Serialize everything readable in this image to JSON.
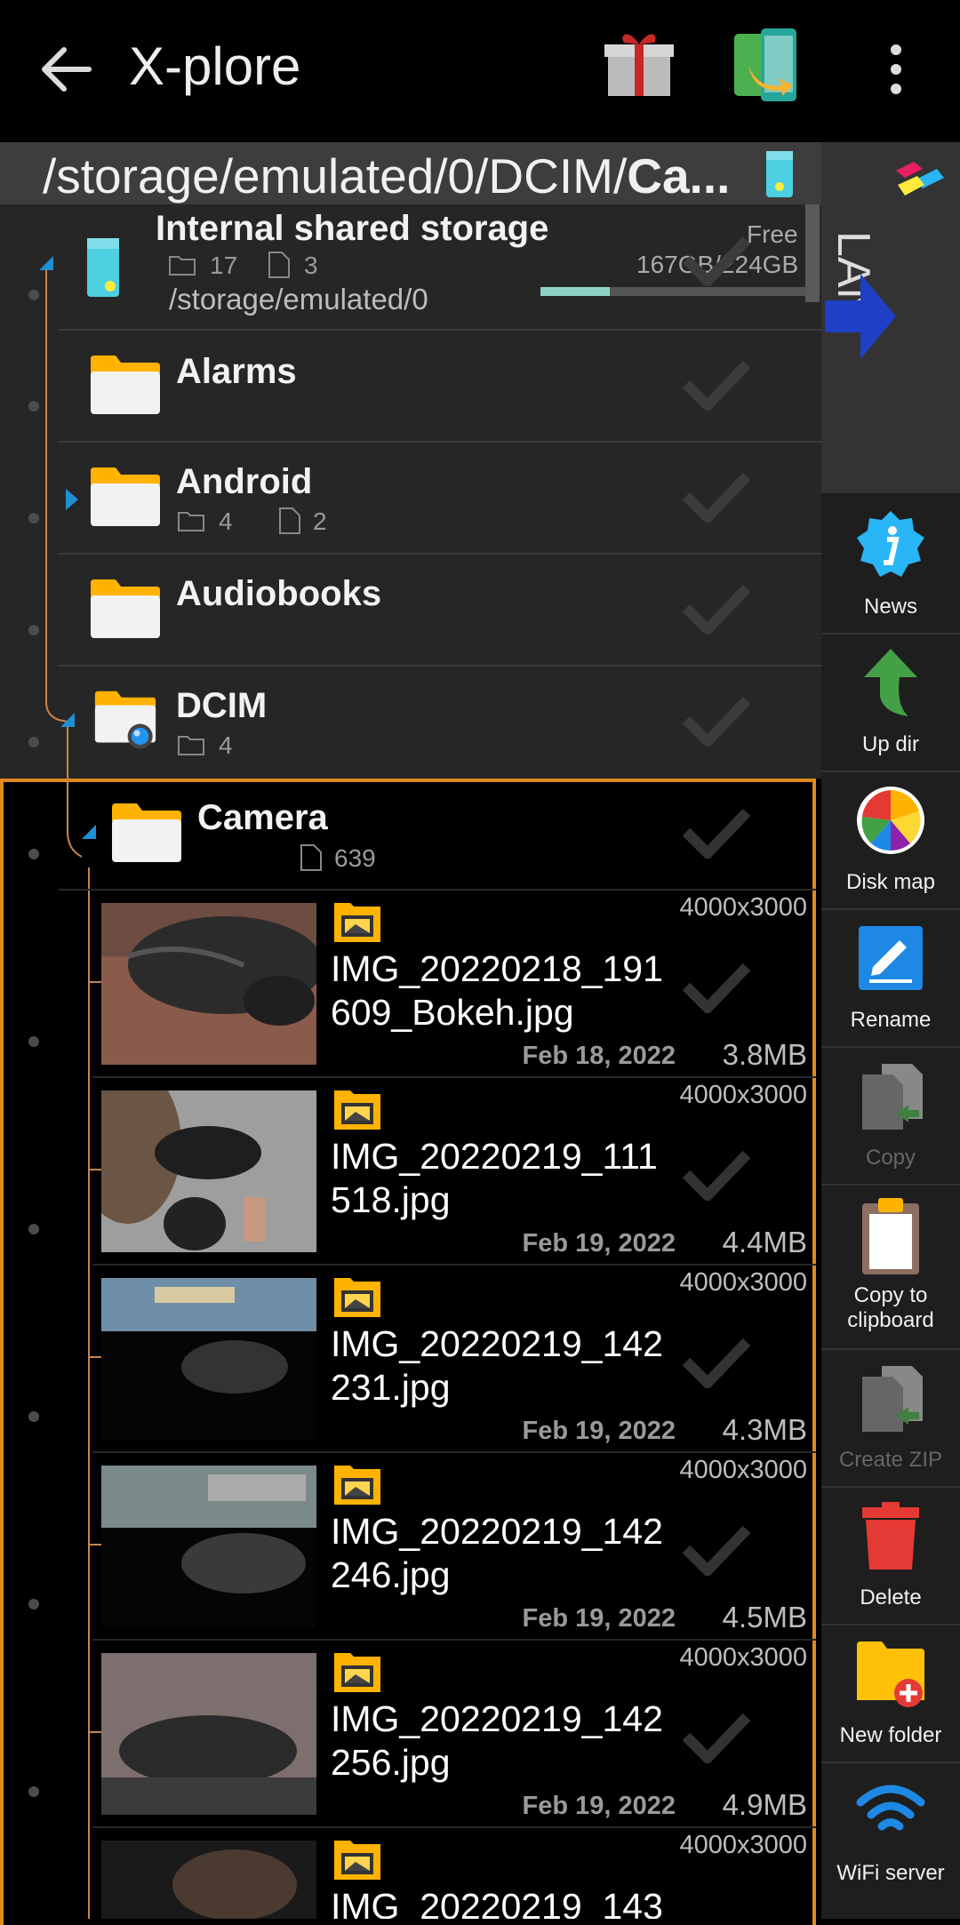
{
  "app": {
    "title": "X-plore"
  },
  "path": {
    "prefix": "/storage/emulated/0/DCIM/",
    "current": "Ca..."
  },
  "storage": {
    "title": "Internal shared storage",
    "folders": "17",
    "files": "3",
    "path": "/storage/emulated/0",
    "free_label": "Free",
    "free_value": "167GB/224GB",
    "used_fraction": 0.26
  },
  "folders": [
    {
      "name": "Alarms",
      "folders": "",
      "files": ""
    },
    {
      "name": "Android",
      "folders": "4",
      "files": "2"
    },
    {
      "name": "Audiobooks",
      "folders": "",
      "files": ""
    },
    {
      "name": "DCIM",
      "folders": "4",
      "files": ""
    }
  ],
  "camera": {
    "name": "Camera",
    "files": "639"
  },
  "files": [
    {
      "name1": "IMG_20220218_191",
      "name2": "609_Bokeh.jpg",
      "res": "4000x3000",
      "date": "Feb 18, 2022",
      "size": "3.8MB"
    },
    {
      "name1": "IMG_20220219_111",
      "name2": "518.jpg",
      "res": "4000x3000",
      "date": "Feb 19, 2022",
      "size": "4.4MB"
    },
    {
      "name1": "IMG_20220219_142",
      "name2": "231.jpg",
      "res": "4000x3000",
      "date": "Feb 19, 2022",
      "size": "4.3MB"
    },
    {
      "name1": "IMG_20220219_142",
      "name2": "246.jpg",
      "res": "4000x3000",
      "date": "Feb 19, 2022",
      "size": "4.5MB"
    },
    {
      "name1": "IMG_20220219_142",
      "name2": "256.jpg",
      "res": "4000x3000",
      "date": "Feb 19, 2022",
      "size": "4.9MB"
    },
    {
      "name1": "IMG_20220219_143",
      "name2": "",
      "res": "4000x3000",
      "date": "",
      "size": ""
    }
  ],
  "sidebar": {
    "lan": "LAN",
    "news": "News",
    "updir": "Up dir",
    "diskmap": "Disk map",
    "rename": "Rename",
    "copy": "Copy",
    "copy_clip_1": "Copy to",
    "copy_clip_2": "clipboard",
    "create_zip": "Create ZIP",
    "delete": "Delete",
    "new_folder": "New folder",
    "wifi": "WiFi server"
  },
  "colors": {
    "accent": "#e08a1e",
    "folder": "#ffb300",
    "tree": "#c9844a",
    "marker": "#1e90d6"
  }
}
